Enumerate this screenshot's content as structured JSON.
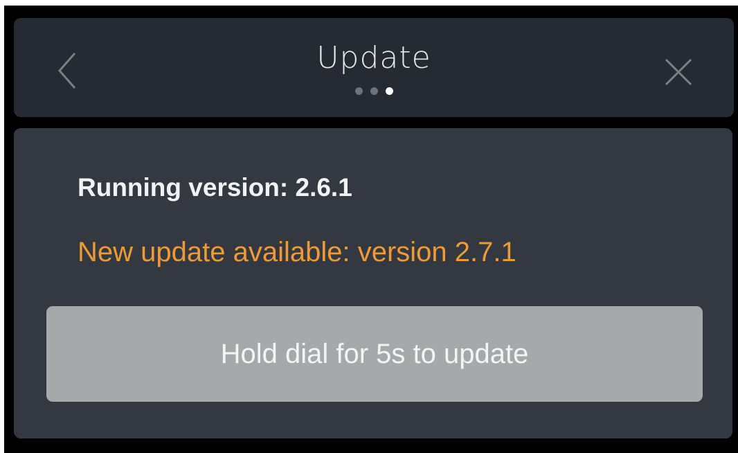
{
  "header": {
    "title": "Update",
    "back_icon": "chevron-left-icon",
    "close_icon": "close-icon",
    "pagination": {
      "total": 3,
      "active_index": 2
    }
  },
  "content": {
    "running_version": "Running version: 2.6.1",
    "new_update": "New update available: version 2.7.1",
    "hold_button_label": "Hold dial for 5s to update"
  },
  "colors": {
    "accent": "#ee9a35",
    "header_bg": "#262a33",
    "panel_bg": "#343841",
    "button_bg": "#a7a8a9"
  }
}
